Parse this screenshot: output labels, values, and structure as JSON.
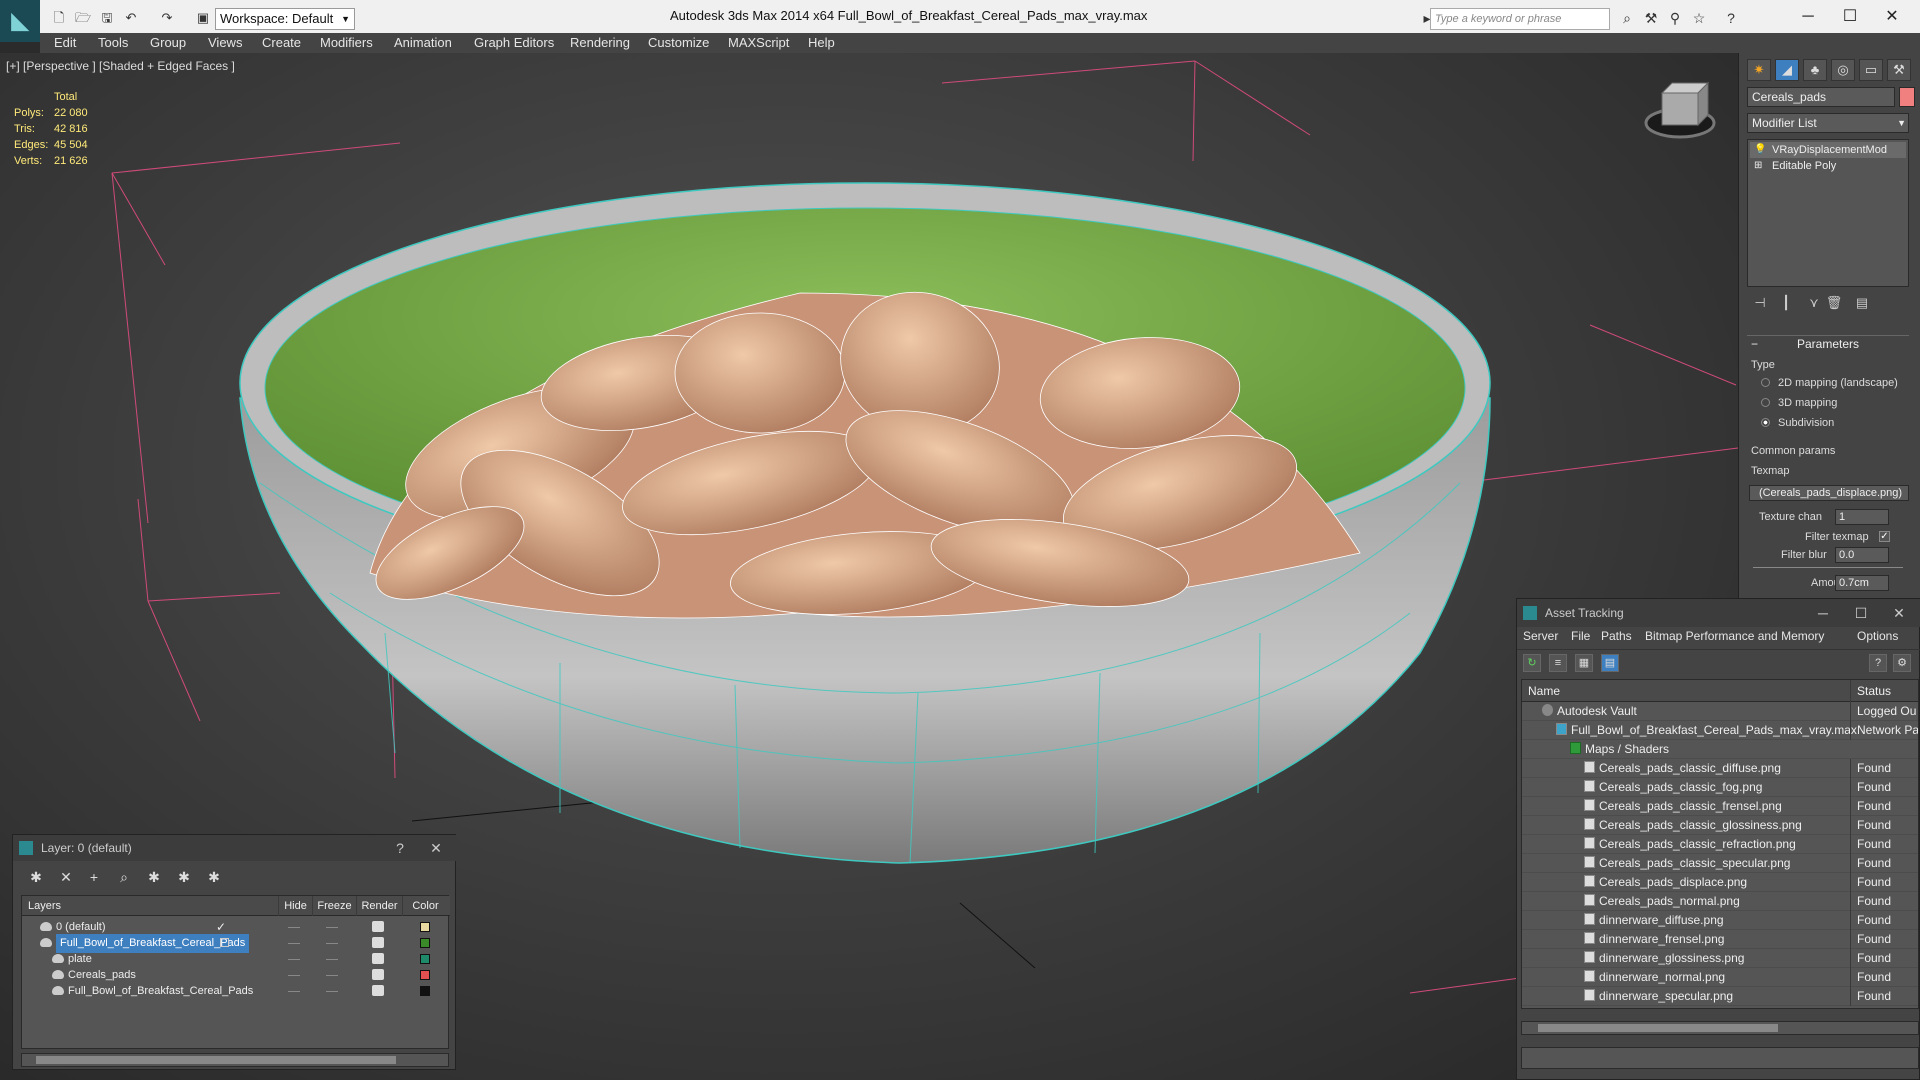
{
  "window": {
    "title": "Autodesk 3ds Max  2014 x64      Full_Bowl_of_Breakfast_Cereal_Pads_max_vray.max",
    "workspace": "Workspace: Default",
    "search_placeholder": "Type a keyword or phrase"
  },
  "menubar": [
    "Edit",
    "Tools",
    "Group",
    "Views",
    "Create",
    "Modifiers",
    "Animation",
    "Graph Editors",
    "Rendering",
    "Customize",
    "MAXScript",
    "Help"
  ],
  "viewport": {
    "label": "[+] [Perspective ] [Shaded + Edged Faces ]",
    "stats": {
      "header": "Total",
      "polys_label": "Polys:",
      "polys": "22 080",
      "tris_label": "Tris:",
      "tris": "42 816",
      "edges_label": "Edges:",
      "edges": "45 504",
      "verts_label": "Verts:",
      "verts": "21 626"
    },
    "colors": {
      "bowl_inner": "#6fa342",
      "bowl_outer": "#a8a8a8",
      "wire": "#3ec9c0",
      "cereal": "#d9a88a"
    }
  },
  "command_panel": {
    "object_name": "Cereals_pads",
    "object_color": "#f08080",
    "modifier_list": "Modifier List",
    "stack": [
      "VRayDisplacementMod",
      "Editable Poly"
    ],
    "rollout": "Parameters",
    "type_group": "Type",
    "type_options": [
      "2D mapping (landscape)",
      "3D mapping",
      "Subdivision"
    ],
    "type_selected": "Subdivision",
    "common_group": "Common params",
    "texmap_label": "Texmap",
    "texmap_value": "(Cereals_pads_displace.png)",
    "texture_chan_label": "Texture chan",
    "texture_chan": "1",
    "filter_texmap_label": "Filter texmap",
    "filter_blur_label": "Filter blur",
    "filter_blur": "0.0",
    "amount_label": "Amount",
    "amount": "0.7cm"
  },
  "asset_tracking": {
    "title": "Asset Tracking",
    "menu": [
      "Server",
      "File",
      "Paths",
      "Bitmap Performance and Memory",
      "Options"
    ],
    "columns": [
      "Name",
      "Status"
    ],
    "rows": [
      {
        "name": "Autodesk Vault",
        "status": "Logged Ou",
        "indent": 1,
        "icon": "vault"
      },
      {
        "name": "Full_Bowl_of_Breakfast_Cereal_Pads_max_vray.max",
        "status": "Network Pa",
        "indent": 2,
        "icon": "max"
      },
      {
        "name": "Maps / Shaders",
        "status": "",
        "indent": 3,
        "icon": "map"
      },
      {
        "name": "Cereals_pads_classic_diffuse.png",
        "status": "Found",
        "indent": 4,
        "icon": "file"
      },
      {
        "name": "Cereals_pads_classic_fog.png",
        "status": "Found",
        "indent": 4,
        "icon": "file"
      },
      {
        "name": "Cereals_pads_classic_frensel.png",
        "status": "Found",
        "indent": 4,
        "icon": "file"
      },
      {
        "name": "Cereals_pads_classic_glossiness.png",
        "status": "Found",
        "indent": 4,
        "icon": "file"
      },
      {
        "name": "Cereals_pads_classic_refraction.png",
        "status": "Found",
        "indent": 4,
        "icon": "file"
      },
      {
        "name": "Cereals_pads_classic_specular.png",
        "status": "Found",
        "indent": 4,
        "icon": "file"
      },
      {
        "name": "Cereals_pads_displace.png",
        "status": "Found",
        "indent": 4,
        "icon": "file"
      },
      {
        "name": "Cereals_pads_normal.png",
        "status": "Found",
        "indent": 4,
        "icon": "file"
      },
      {
        "name": "dinnerware_diffuse.png",
        "status": "Found",
        "indent": 4,
        "icon": "file"
      },
      {
        "name": "dinnerware_frensel.png",
        "status": "Found",
        "indent": 4,
        "icon": "file"
      },
      {
        "name": "dinnerware_glossiness.png",
        "status": "Found",
        "indent": 4,
        "icon": "file"
      },
      {
        "name": "dinnerware_normal.png",
        "status": "Found",
        "indent": 4,
        "icon": "file"
      },
      {
        "name": "dinnerware_specular.png",
        "status": "Found",
        "indent": 4,
        "icon": "file"
      }
    ]
  },
  "layers": {
    "title": "Layer: 0 (default)",
    "help": "?",
    "columns": [
      "Layers",
      "Hide",
      "Freeze",
      "Render",
      "Color"
    ],
    "rows": [
      {
        "name": "0 (default)",
        "indent": 1,
        "color": "#e8d9a0",
        "current": true,
        "selected": false
      },
      {
        "name": "Full_Bowl_of_Breakfast_Cereal_Pads",
        "indent": 1,
        "color": "#3a8a2a",
        "current": false,
        "selected": true
      },
      {
        "name": "plate",
        "indent": 2,
        "color": "#1f8a6a",
        "current": false,
        "selected": false
      },
      {
        "name": "Cereals_pads",
        "indent": 2,
        "color": "#e05050",
        "current": false,
        "selected": false
      },
      {
        "name": "Full_Bowl_of_Breakfast_Cereal_Pads",
        "indent": 2,
        "color": "#111111",
        "current": false,
        "selected": false
      }
    ]
  }
}
